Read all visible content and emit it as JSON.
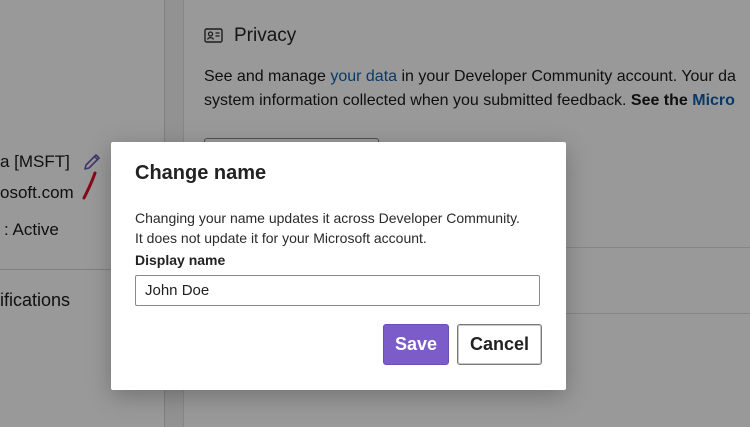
{
  "profile": {
    "name_fragment": "a [MSFT]",
    "email_fragment": "osoft.com",
    "status_fragment": ": Active"
  },
  "nav": {
    "notifications_fragment": "ifications"
  },
  "privacy": {
    "title": "Privacy",
    "line1_pre": "See and manage ",
    "line1_link": "your data",
    "line1_post": " in your Developer Community account. Your da",
    "line2_pre": "system information collected when you submitted feedback. ",
    "line2_bold": "See the ",
    "line2_boldlink": "Micro"
  },
  "dialog": {
    "title": "Change name",
    "desc_line1": "Changing your name updates it across Developer Community.",
    "desc_line2": "It does not update it for your Microsoft account.",
    "field_label": "Display name",
    "field_value": "John Doe",
    "save_label": "Save",
    "cancel_label": "Cancel"
  },
  "colors": {
    "accent_purple": "#7b5cc8",
    "link_blue": "#0f5fb0",
    "overlay": "rgba(0,0,0,0.40)"
  },
  "icons": [
    "edit-pencil-icon",
    "privacy-icon"
  ]
}
